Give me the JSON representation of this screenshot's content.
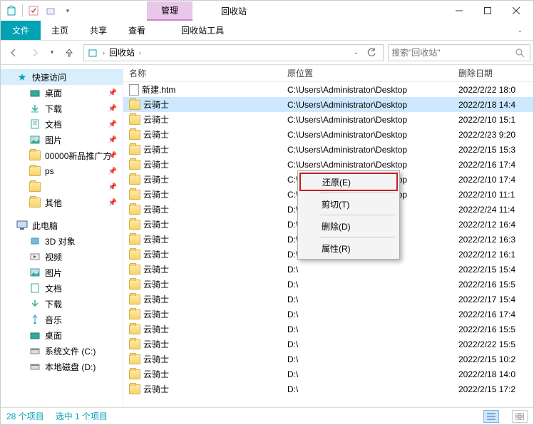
{
  "window": {
    "title": "回收站",
    "manage_tab": "管理",
    "tools_tab": "回收站工具"
  },
  "ribbon": {
    "file": "文件",
    "home": "主页",
    "share": "共享",
    "view": "查看"
  },
  "nav": {
    "location_root": "回收站",
    "sep": "›",
    "search_placeholder": "搜索\"回收站\""
  },
  "sidebar": {
    "quick": "快速访问",
    "items": [
      {
        "label": "桌面",
        "pinned": true
      },
      {
        "label": "下载",
        "pinned": true
      },
      {
        "label": "文档",
        "pinned": true
      },
      {
        "label": "图片",
        "pinned": true
      },
      {
        "label": "00000新品推广方",
        "pinned": true
      },
      {
        "label": "ps",
        "pinned": true
      },
      {
        "label": "",
        "pinned": true
      },
      {
        "label": "其他",
        "pinned": true
      }
    ],
    "thispc": "此电脑",
    "pc_items": [
      {
        "label": "3D 对象"
      },
      {
        "label": "视频"
      },
      {
        "label": "图片"
      },
      {
        "label": "文档"
      },
      {
        "label": "下载"
      },
      {
        "label": "音乐"
      },
      {
        "label": "桌面"
      },
      {
        "label": "系统文件 (C:)"
      },
      {
        "label": "本地磁盘 (D:)"
      }
    ]
  },
  "columns": {
    "name": "名称",
    "loc": "原位置",
    "date": "删除日期"
  },
  "rows": [
    {
      "type": "file",
      "name": "新建.htm",
      "loc": "C:\\Users\\Administrator\\Desktop",
      "date": "2022/2/22 18:0"
    },
    {
      "type": "folder",
      "name": "云骑士",
      "loc": "C:\\Users\\Administrator\\Desktop",
      "date": "2022/2/18 14:4",
      "sel": true
    },
    {
      "type": "folder",
      "name": "云骑士",
      "loc": "C:\\Users\\Administrator\\Desktop",
      "date": "2022/2/10 15:1"
    },
    {
      "type": "folder",
      "name": "云骑士",
      "loc": "C:\\Users\\Administrator\\Desktop",
      "date": "2022/2/23 9:20"
    },
    {
      "type": "folder",
      "name": "云骑士",
      "loc": "C:\\Users\\Administrator\\Desktop",
      "date": "2022/2/15 15:3"
    },
    {
      "type": "folder",
      "name": "云骑士",
      "loc": "C:\\Users\\Administrator\\Desktop",
      "date": "2022/2/16 17:4"
    },
    {
      "type": "folder",
      "name": "云骑士",
      "loc": "C:\\Users\\Administrator\\Desktop",
      "date": "2022/2/10 17:4"
    },
    {
      "type": "folder",
      "name": "云骑士",
      "loc": "C:\\Users\\Administrator\\Desktop",
      "date": "2022/2/10 11:1"
    },
    {
      "type": "folder",
      "name": "云骑士",
      "loc": "D:\\",
      "date": "2022/2/24 11:4"
    },
    {
      "type": "folder",
      "name": "云骑士",
      "loc": "D:\\",
      "date": "2022/2/12 16:4"
    },
    {
      "type": "folder",
      "name": "云骑士",
      "loc": "D:\\",
      "date": "2022/2/12 16:3"
    },
    {
      "type": "folder",
      "name": "云骑士",
      "loc": "D:\\",
      "date": "2022/2/12 16:1"
    },
    {
      "type": "folder",
      "name": "云骑士",
      "loc": "D:\\",
      "date": "2022/2/15 15:4"
    },
    {
      "type": "folder",
      "name": "云骑士",
      "loc": "D:\\",
      "date": "2022/2/16 15:5"
    },
    {
      "type": "folder",
      "name": "云骑士",
      "loc": "D:\\",
      "date": "2022/2/17 15:4"
    },
    {
      "type": "folder",
      "name": "云骑士",
      "loc": "D:\\",
      "date": "2022/2/16 17:4"
    },
    {
      "type": "folder",
      "name": "云骑士",
      "loc": "D:\\",
      "date": "2022/2/16 15:5"
    },
    {
      "type": "folder",
      "name": "云骑士",
      "loc": "D:\\",
      "date": "2022/2/22 15:5"
    },
    {
      "type": "folder",
      "name": "云骑士",
      "loc": "D:\\",
      "date": "2022/2/15 10:2"
    },
    {
      "type": "folder",
      "name": "云骑士",
      "loc": "D:\\",
      "date": "2022/2/18 14:0"
    },
    {
      "type": "folder",
      "name": "云骑士",
      "loc": "D:\\",
      "date": "2022/2/15 17:2"
    }
  ],
  "context_menu": {
    "restore": "还原(E)",
    "cut": "剪切(T)",
    "delete": "删除(D)",
    "properties": "属性(R)"
  },
  "status": {
    "count": "28 个项目",
    "selected": "选中 1 个项目"
  }
}
